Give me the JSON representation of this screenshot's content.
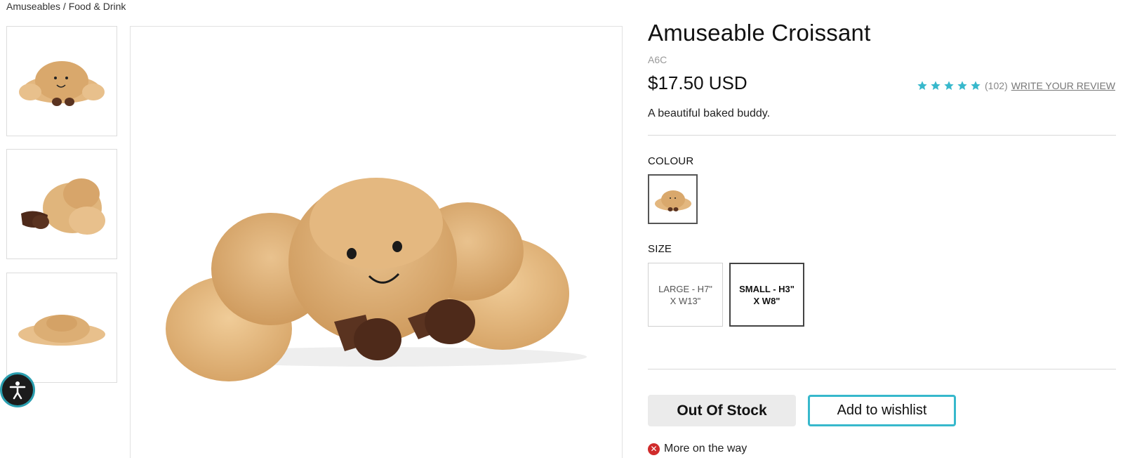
{
  "breadcrumb": "Amuseables / Food & Drink",
  "product": {
    "title": "Amuseable Croissant",
    "sku": "A6C",
    "price": "$17.50 USD",
    "description": "A beautiful baked buddy."
  },
  "rating": {
    "stars": 5,
    "count": "(102)",
    "review_link": "WRITE YOUR REVIEW",
    "star_color": "#37b8cc"
  },
  "colour": {
    "label": "COLOUR"
  },
  "size": {
    "label": "SIZE",
    "options": [
      {
        "label": "LARGE - H7\" X W13\"",
        "selected": false
      },
      {
        "label": "SMALL - H3\" X W8\"",
        "selected": true
      }
    ]
  },
  "actions": {
    "out_of_stock": "Out Of Stock",
    "wishlist": "Add to wishlist"
  },
  "status": {
    "restock": "More on the way",
    "restock_icon": "x-circle-icon"
  },
  "colors": {
    "accent": "#37b8cc",
    "error": "#d02b2b",
    "croissant": "#e0b57c",
    "legs": "#5a3320"
  }
}
